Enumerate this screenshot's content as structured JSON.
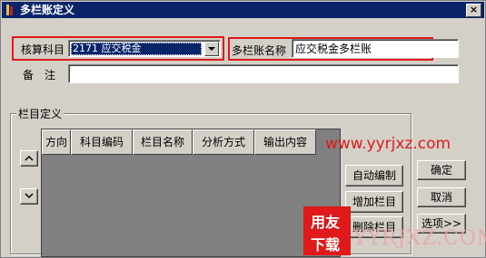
{
  "window": {
    "title": "多栏账定义",
    "close_glyph": "×"
  },
  "form": {
    "account_label": "核算科目",
    "account_value": "2171  应交税金",
    "name_label": "多栏账名称",
    "name_value": "应交税金多栏账",
    "remark_label": "备　注",
    "remark_value": ""
  },
  "columns_group": {
    "label": "栏目定义",
    "headers": [
      "方向",
      "科目编码",
      "栏目名称",
      "分析方式",
      "输出内容"
    ]
  },
  "buttons": {
    "auto": "自动编制",
    "add": "增加栏目",
    "delete": "删除栏目",
    "ok": "确定",
    "cancel": "取消",
    "options": "选项>>"
  },
  "watermark": {
    "url": "www.yyrjxz.com",
    "logo_top": "用友",
    "logo_bottom": "下载",
    "big": "YYRJXZ.COM"
  },
  "colors": {
    "title_bar": "#0a246a",
    "highlight_border": "#e0191a",
    "face": "#d4d0c8"
  }
}
